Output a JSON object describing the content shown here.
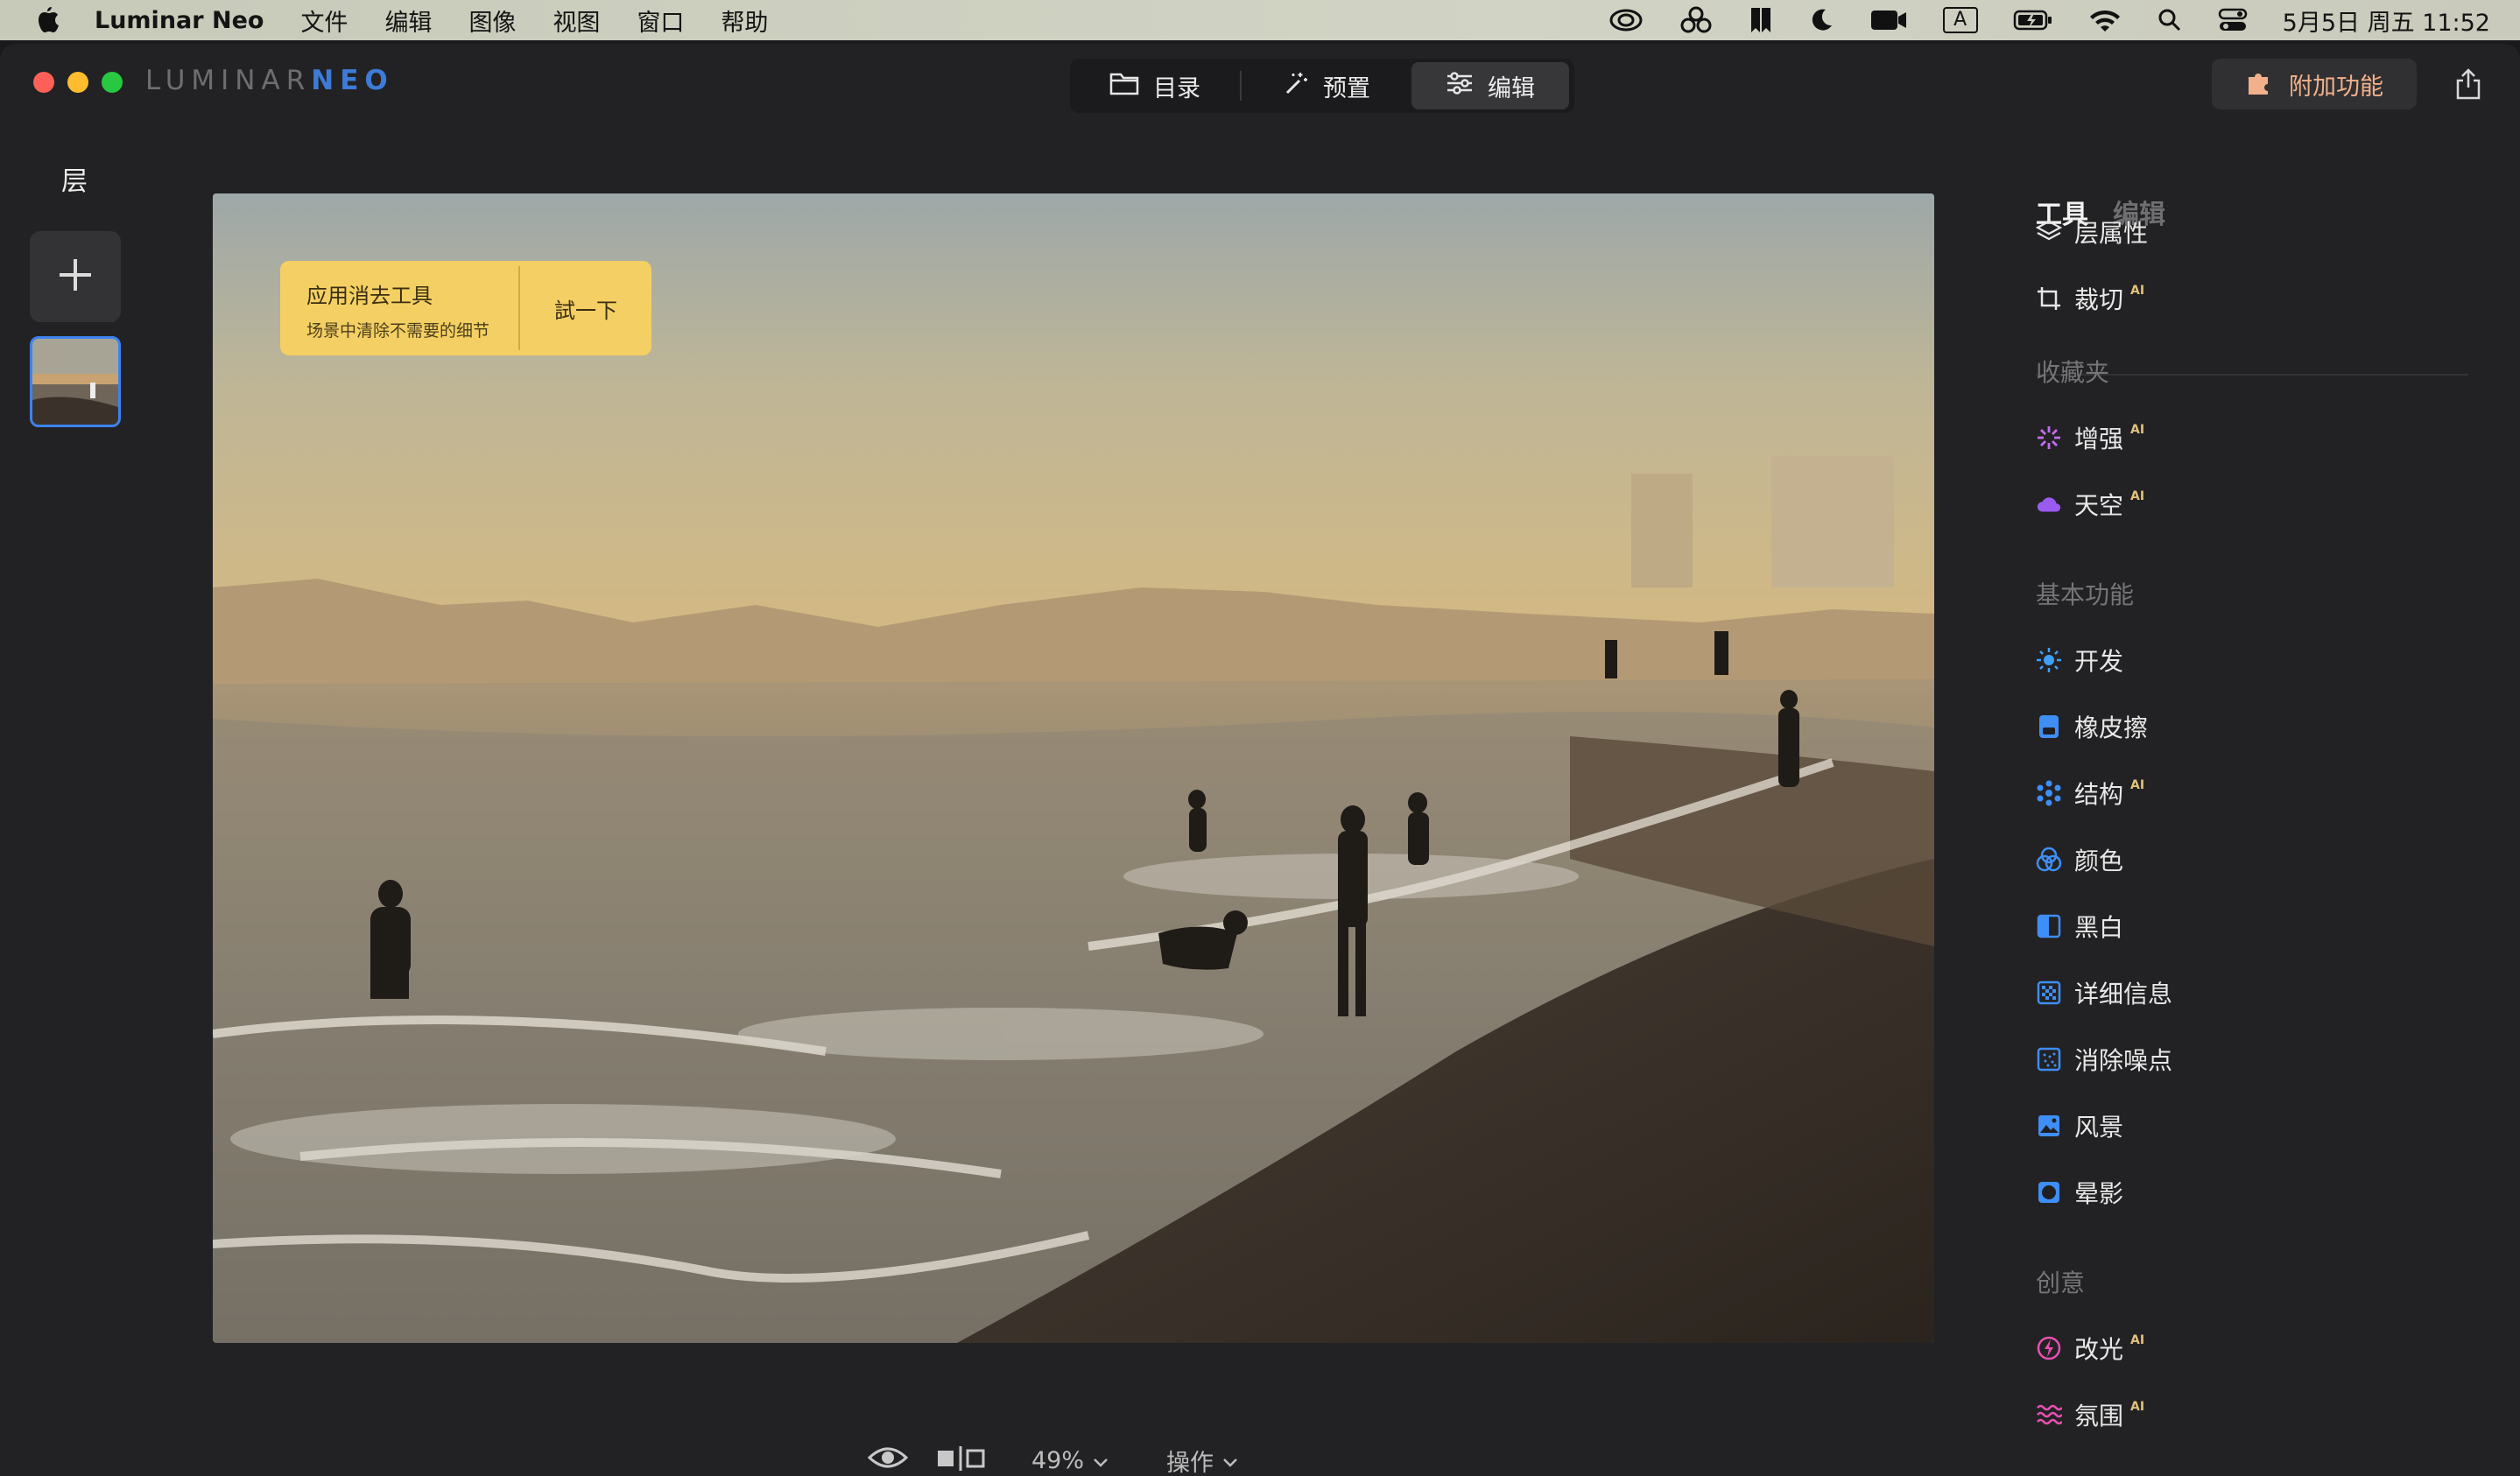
{
  "menubar": {
    "app_name": "Luminar Neo",
    "menus": [
      "文件",
      "编辑",
      "图像",
      "视图",
      "窗口",
      "帮助"
    ],
    "clock": "5月5日 周五 11:52",
    "input_method": "A"
  },
  "window": {
    "logo_text_a": "LUMINAR",
    "logo_text_b": "NEO",
    "modes": [
      "目录",
      "预置",
      "编辑"
    ],
    "active_mode": "编辑",
    "extras_label": "附加功能"
  },
  "layers": {
    "title": "层"
  },
  "hint": {
    "title": "应用消去工具",
    "subtitle": "场景中清除不需要的细节",
    "action": "試一下"
  },
  "bottom": {
    "zoom": "49%",
    "actions": "操作"
  },
  "right_panel": {
    "tabs": [
      "工具",
      "编辑"
    ],
    "tools": [
      {
        "label": "层属性"
      },
      {
        "label": "裁切",
        "ai": "AI"
      }
    ],
    "favorites_title": "收藏夹",
    "favorites": [
      {
        "label": "增强",
        "ai": "AI"
      },
      {
        "label": "天空",
        "ai": "AI"
      }
    ],
    "essentials_title": "基本功能",
    "essentials": [
      {
        "label": "开发"
      },
      {
        "label": "橡皮擦"
      },
      {
        "label": "结构",
        "ai": "AI"
      },
      {
        "label": "颜色"
      },
      {
        "label": "黑白"
      },
      {
        "label": "详细信息"
      },
      {
        "label": "消除噪点"
      },
      {
        "label": "风景"
      },
      {
        "label": "晕影"
      }
    ],
    "creative_title": "创意",
    "creative": [
      {
        "label": "改光",
        "ai": "AI"
      },
      {
        "label": "氛围",
        "ai": "AI"
      }
    ]
  },
  "colors": {
    "accent": "#3d82f0",
    "hint_bg": "#f4cf63",
    "extras_text": "#f2b18a",
    "ai_badge": "#e2c27d"
  }
}
